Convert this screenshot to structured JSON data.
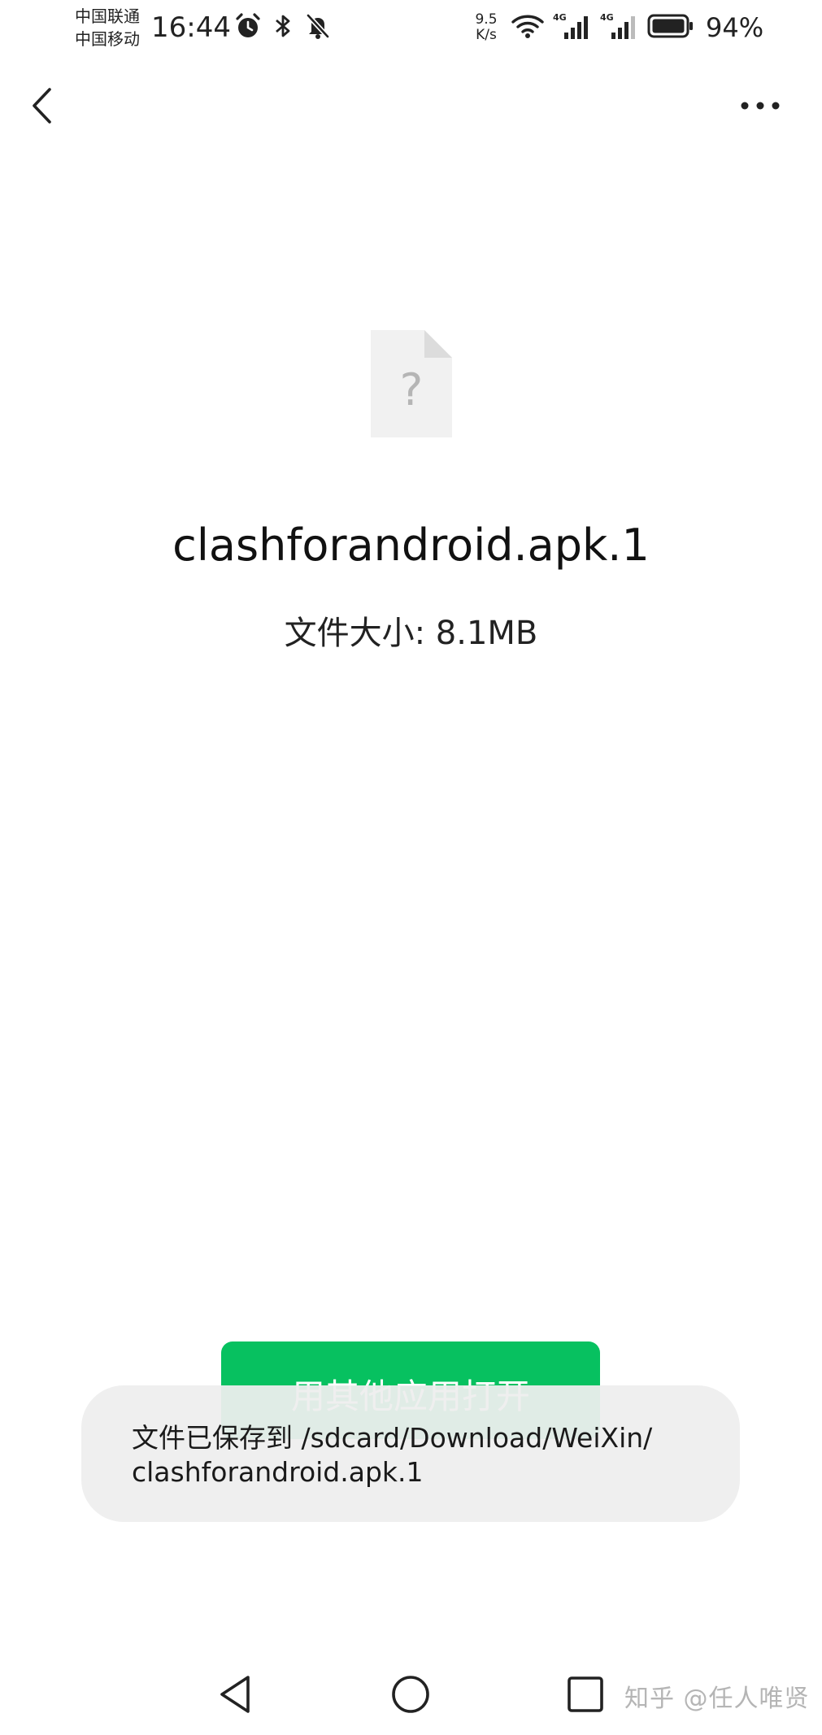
{
  "status_bar": {
    "carrier_1": "中国联通",
    "carrier_2": "中国移动",
    "time": "16:44",
    "net_speed_value": "9.5",
    "net_speed_unit": "K/s",
    "battery_percent": "94%",
    "icons": [
      "alarm-icon",
      "bluetooth-icon",
      "mute-bell-icon",
      "wifi-icon",
      "signal-4g-icon",
      "signal-4g-icon",
      "battery-icon"
    ]
  },
  "app_bar": {
    "back_icon": "chevron-left-icon",
    "more_icon": "more-horizontal-icon"
  },
  "file": {
    "icon": "unknown-file-icon",
    "icon_glyph": "?",
    "name": "clashforandroid.apk.1",
    "size_label": "文件大小: 8.1MB"
  },
  "actions": {
    "open_with_other_app": "用其他应用打开"
  },
  "toast": {
    "line_1": "文件已保存到 /sdcard/Download/WeiXin/",
    "line_2": "clashforandroid.apk.1"
  },
  "nav_bar": {
    "icons": [
      "nav-back-icon",
      "nav-home-icon",
      "nav-recent-icon"
    ]
  },
  "watermark": "知乎 @任人唯贤",
  "colors": {
    "primary_green": "#07c160",
    "toast_bg": "#eeeeee",
    "file_icon_bg": "#f1f1f1",
    "file_icon_fold": "#dcdcdc"
  }
}
